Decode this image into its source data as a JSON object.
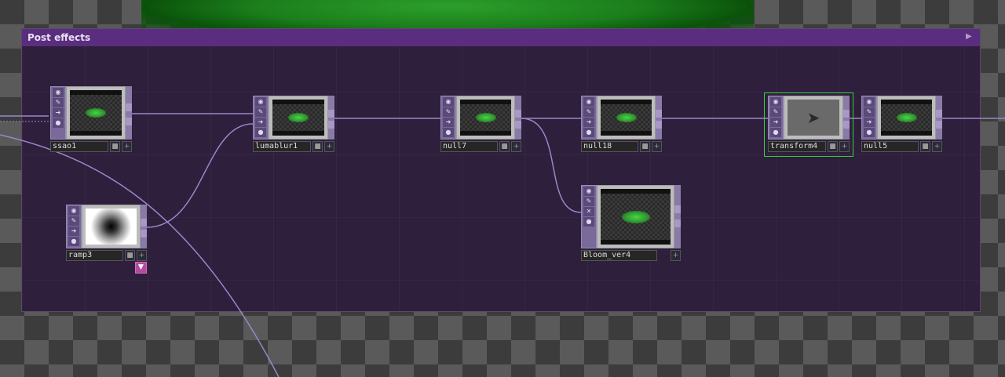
{
  "container": {
    "title": "Post effects",
    "viewer_icon": "viewer-toggle-icon"
  },
  "nodes": [
    {
      "id": "ssao1",
      "label": "ssao1",
      "thumbnail": "green-blob"
    },
    {
      "id": "lumablur1",
      "label": "lumablur1",
      "thumbnail": "green-blob"
    },
    {
      "id": "null7",
      "label": "null7",
      "thumbnail": "green-blob"
    },
    {
      "id": "null18",
      "label": "null18",
      "thumbnail": "green-blob"
    },
    {
      "id": "transform4",
      "label": "transform4",
      "thumbnail": "arrow",
      "selected": true
    },
    {
      "id": "null5",
      "label": "null5",
      "thumbnail": "green-blob"
    },
    {
      "id": "ramp3",
      "label": "ramp3",
      "thumbnail": "radial-gradient"
    },
    {
      "id": "bloom_ver4",
      "label": "Bloom_ver4",
      "thumbnail": "green-blob"
    }
  ],
  "connections": [
    [
      "ssao1",
      "lumablur1"
    ],
    [
      "ramp3",
      "lumablur1"
    ],
    [
      "lumablur1",
      "null7"
    ],
    [
      "null7",
      "null18"
    ],
    [
      "null7",
      "bloom_ver4"
    ],
    [
      "null18",
      "transform4"
    ],
    [
      "transform4",
      "null5"
    ]
  ],
  "colors": {
    "container_header": "#5a2d7e",
    "container_body": "#2e1f3c",
    "wire": "#9a86c8",
    "selected_outline": "#38d038",
    "node_strip": "#7a6a9a"
  },
  "icons": {
    "strip": [
      "viewer-icon",
      "bypass-icon",
      "cook-icon",
      "lock-icon"
    ],
    "strip_bloom": [
      "viewer-icon",
      "bypass-icon",
      "clear-icon",
      "lock-icon"
    ],
    "ramp_flag": "down-arrow-icon"
  }
}
